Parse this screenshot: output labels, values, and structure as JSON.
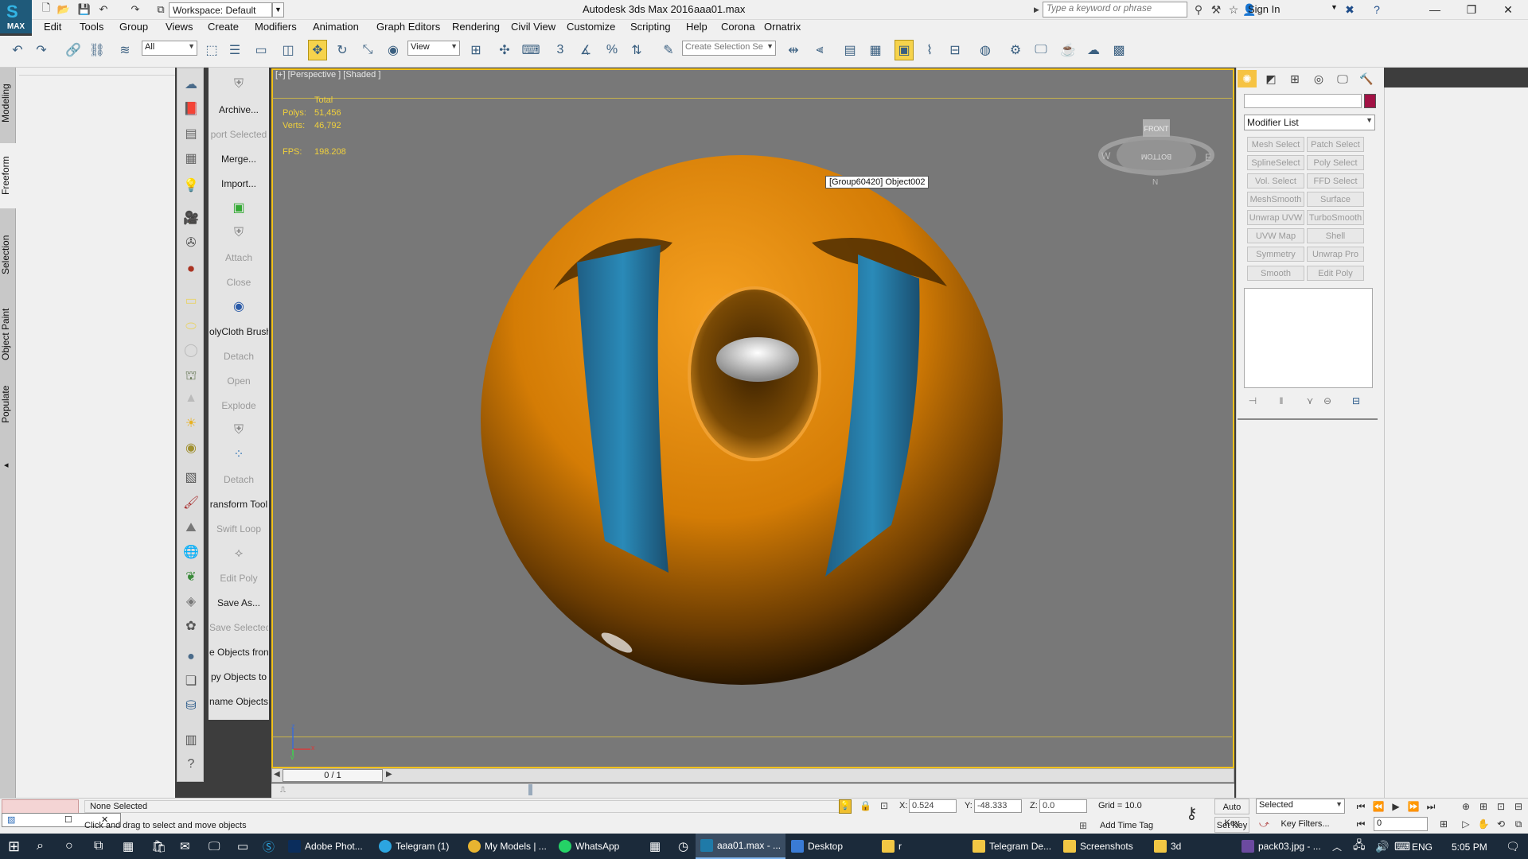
{
  "app": {
    "logo_text": "MAX",
    "title": "Autodesk 3ds Max 2016",
    "file": "aaa01.max",
    "workspace": "Workspace: Default",
    "search_placeholder": "Type a keyword or phrase",
    "signin": "Sign In"
  },
  "menu": [
    "Edit",
    "Tools",
    "Group",
    "Views",
    "Create",
    "Modifiers",
    "Animation",
    "Graph Editors",
    "Rendering",
    "Civil View",
    "Customize",
    "Scripting",
    "Help",
    "Corona",
    "Ornatrix"
  ],
  "toolbar": {
    "selection_filter": "All",
    "ref_coord": "View",
    "create_selection_set": "Create Selection Se"
  },
  "ribbon_tabs": [
    "Modeling",
    "Freeform",
    "Selection",
    "Object Paint",
    "Populate"
  ],
  "command_column": [
    {
      "label": "Archive...",
      "disabled": false
    },
    {
      "label": "port Selected",
      "disabled": true
    },
    {
      "label": "Merge...",
      "disabled": false
    },
    {
      "label": "Import...",
      "disabled": false
    },
    {
      "label": "Attach",
      "disabled": true
    },
    {
      "label": "Close",
      "disabled": true
    },
    {
      "label": "olyCloth Brush",
      "disabled": false
    },
    {
      "label": "Detach",
      "disabled": true
    },
    {
      "label": "Open",
      "disabled": true
    },
    {
      "label": "Explode",
      "disabled": true
    },
    {
      "label": "Detach",
      "disabled": true
    },
    {
      "label": "ransform Tool",
      "disabled": false
    },
    {
      "label": "Swift Loop",
      "disabled": true
    },
    {
      "label": "Edit Poly",
      "disabled": true
    },
    {
      "label": "Save As...",
      "disabled": false
    },
    {
      "label": "Save Selected",
      "disabled": true
    },
    {
      "label": "e Objects fron",
      "disabled": false
    },
    {
      "label": "py Objects to",
      "disabled": false
    },
    {
      "label": "name Objects",
      "disabled": false
    }
  ],
  "viewport": {
    "label": "[+] [Perspective ] [Shaded ]",
    "stats": {
      "header": "Total",
      "polys_label": "Polys:",
      "polys": "51,456",
      "verts_label": "Verts:",
      "verts": "46,792",
      "fps_label": "FPS:",
      "fps": "198.208"
    },
    "tooltip": "[Group60420] Object002",
    "viewcube": {
      "front": "FRONT",
      "bottom": "BOTTOM",
      "w": "W",
      "e": "E",
      "n": "N"
    },
    "axis": {
      "z": "z",
      "x": "x",
      "y": "y"
    }
  },
  "command_panel": {
    "modifier_list": "Modifier List",
    "color_swatch": "#a21245",
    "modifiers": [
      "Mesh Select",
      "Patch Select",
      "SplineSelect",
      "Poly Select",
      "Vol. Select",
      "FFD Select",
      "MeshSmooth",
      "Surface Select",
      "Unwrap UVW",
      "TurboSmooth",
      "UVW Map",
      "Shell",
      "Symmetry",
      "Unwrap Pro",
      "Smooth",
      "Edit Poly"
    ]
  },
  "timeline": {
    "frame": "0 / 1"
  },
  "status": {
    "selection": "None Selected",
    "prompt": "Click and drag to select and move objects",
    "x_label": "X:",
    "x": "0.524",
    "y_label": "Y:",
    "y": "-48.333",
    "z_label": "Z:",
    "z": "0.0",
    "grid": "Grid = 10.0",
    "add_time_tag": "Add Time Tag",
    "auto_key": "Auto Key",
    "set_key": "Set Key",
    "key_mode": "Selected",
    "key_filters": "Key Filters...",
    "frame_input": "0"
  },
  "taskbar": {
    "items": [
      {
        "label": "Adobe Phot...",
        "color": "#0a2d5c"
      },
      {
        "label": "Telegram (1)",
        "color": "#2ca5e0"
      },
      {
        "label": "My Models | ...",
        "color": "#e8b430"
      },
      {
        "label": "WhatsApp",
        "color": "#25d366"
      },
      {
        "label": "aaa01.max - ...",
        "color": "#1f7aa8"
      },
      {
        "label": "Desktop",
        "color": "#3a7bd5"
      },
      {
        "label": "r",
        "color": "#f2c744"
      },
      {
        "label": "Telegram De...",
        "color": "#f2c744"
      },
      {
        "label": "Screenshots",
        "color": "#f2c744"
      },
      {
        "label": "3d",
        "color": "#f2c744"
      },
      {
        "label": "pack03.jpg - ...",
        "color": "#6b4aa0"
      }
    ],
    "lang": "ENG",
    "time": "5:05 PM"
  }
}
